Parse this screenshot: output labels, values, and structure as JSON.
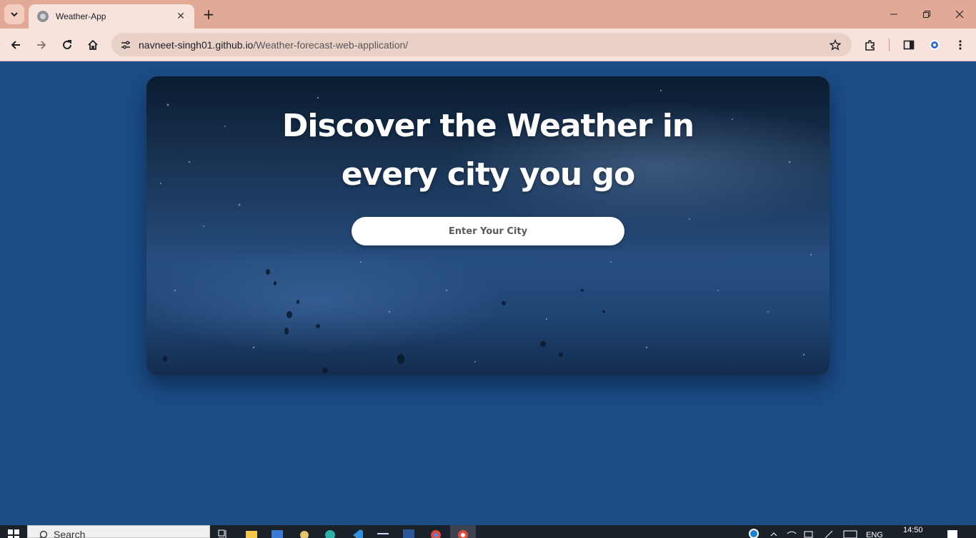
{
  "browser": {
    "tab_title": "Weather-App",
    "url_host": "navneet-singh01.github.io",
    "url_path": "/Weather-forecast-web-application/",
    "icons": [
      "tab-search-icon",
      "globe-icon",
      "close-icon",
      "plus-icon",
      "minimize-icon",
      "restore-icon",
      "back-icon",
      "forward-icon",
      "reload-icon",
      "home-icon",
      "site-info-icon",
      "star-icon",
      "extensions-icon",
      "side-panel-icon",
      "profile-icon",
      "menu-icon"
    ]
  },
  "hero": {
    "headline_line1": "Discover the Weather in",
    "headline_line2": "every city you go",
    "city_placeholder": "Enter Your City"
  },
  "taskbar": {
    "search_label": "Search",
    "language": "ENG",
    "time": "14:50"
  },
  "colors": {
    "page_background": "#1c4d87",
    "tabbar": "#e3a997",
    "toolbar": "#f7e3dc",
    "taskbar": "#1b2129"
  }
}
